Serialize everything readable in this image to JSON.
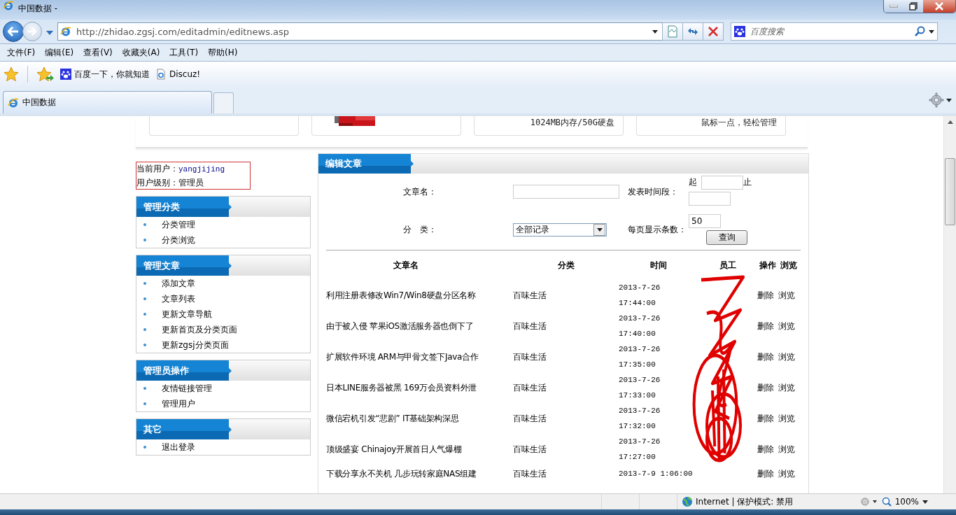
{
  "window": {
    "title": "中国数据 -"
  },
  "address_bar": {
    "url": "http://zhidao.zgsj.com/editadmin/editnews.asp"
  },
  "search": {
    "placeholder": "百度搜索"
  },
  "menu": [
    "文件(F)",
    "编辑(E)",
    "查看(V)",
    "收藏夹(A)",
    "工具(T)",
    "帮助(H)"
  ],
  "favorites": [
    {
      "label": "百度一下，你就知道",
      "kind": "paw"
    },
    {
      "label": "Discuz!",
      "kind": "page"
    }
  ],
  "tabs": [
    {
      "label": "中国数据",
      "selected": true
    }
  ],
  "banner": {
    "cards": [
      {
        "kind": "blank"
      },
      {
        "kind": "picture"
      },
      {
        "kind": "text",
        "text": "1024MB内存/50G硬盘"
      },
      {
        "kind": "text",
        "text": "鼠标一点，轻松管理"
      }
    ]
  },
  "user": {
    "user_label": "当前用户：",
    "username": "yangjijing",
    "level_label": "用户级别：",
    "level": "管理员"
  },
  "sidebar": {
    "sections": [
      {
        "title": "管理分类",
        "items": [
          "分类管理",
          "分类浏览"
        ]
      },
      {
        "title": "管理文章",
        "items": [
          "添加文章",
          "文章列表",
          "更新文章导航",
          "更新首页及分类页面",
          "更新zgsj分类页面"
        ]
      },
      {
        "title": "管理员操作",
        "items": [
          "友情链接管理",
          "管理用户"
        ]
      },
      {
        "title": "其它",
        "items": [
          "退出登录"
        ]
      }
    ]
  },
  "panel": {
    "title": "编辑文章",
    "form": {
      "name_label": "文章名：",
      "period_label": "发表时间段：",
      "from_label": "起",
      "to_label": "止",
      "category_label": "分　类：",
      "category_value": "全部记录",
      "per_page_label": "每页显示条数：",
      "per_page_value": "50",
      "query_button": "查询"
    },
    "table": {
      "columns": [
        "文章名",
        "分类",
        "时间",
        "员工",
        "操作",
        "浏览"
      ],
      "rows": [
        {
          "title": "利用注册表修改Win7/Win8硬盘分区名称",
          "category": "百味生活",
          "time": "2013-7-26 17:44:00",
          "actions": [
            "删除",
            "浏览"
          ]
        },
        {
          "title": "由于被入侵 苹果iOS激活服务器也倒下了",
          "category": "百味生活",
          "time": "2013-7-26 17:40:00",
          "actions": [
            "删除",
            "浏览"
          ]
        },
        {
          "title": "扩展软件环境 ARM与甲骨文签下Java合作",
          "category": "百味生活",
          "time": "2013-7-26 17:35:00",
          "actions": [
            "删除",
            "浏览"
          ]
        },
        {
          "title": "日本LINE服务器被黑 169万会员资料外泄",
          "category": "百味生活",
          "time": "2013-7-26 17:33:00",
          "actions": [
            "删除",
            "浏览"
          ]
        },
        {
          "title": "微信宕机引发“悲剧” IT基础架构深思",
          "category": "百味生活",
          "time": "2013-7-26 17:32:00",
          "actions": [
            "删除",
            "浏览"
          ]
        },
        {
          "title": "顶级盛宴 Chinajoy开展首日人气爆棚",
          "category": "百味生活",
          "time": "2013-7-26 17:27:00",
          "actions": [
            "删除",
            "浏览"
          ]
        },
        {
          "title": "下载分享永不关机 几步玩转家庭NAS组建",
          "category": "百味生活",
          "time": "2013-7-9 1:06:00",
          "actions": [
            "删除",
            "浏览"
          ]
        }
      ]
    }
  },
  "status_bar": {
    "zone": "Internet | 保护模式: 禁用",
    "zoom": "100%"
  }
}
